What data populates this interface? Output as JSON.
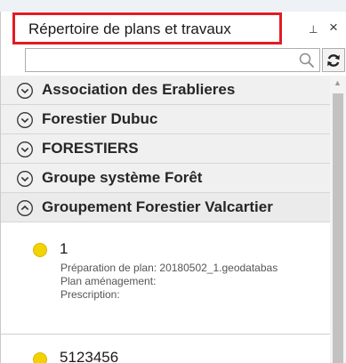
{
  "panel": {
    "title": "Répertoire de plans et travaux",
    "pin_glyph": "⊥",
    "close_glyph": "×"
  },
  "search": {
    "value": "",
    "placeholder": "",
    "icon": "search-icon",
    "refresh_icon": "refresh-icon"
  },
  "groups": [
    {
      "label": "Association des Erablieres",
      "state": "collapsed"
    },
    {
      "label": "Forestier Dubuc",
      "state": "collapsed"
    },
    {
      "label": "FORESTIERS",
      "state": "collapsed"
    },
    {
      "label": "Groupe système Forêt",
      "state": "collapsed"
    },
    {
      "label": "Groupement Forestier Valcartier",
      "state": "expanded"
    }
  ],
  "items": [
    {
      "id": "1",
      "details": [
        "Préparation de plan: 20180502_1.geodatabas",
        "Plan aménagement:",
        "Prescription:"
      ],
      "status_color": "#f2d300"
    },
    {
      "id": "5123456",
      "status_color": "#f2d300"
    }
  ],
  "colors": {
    "highlight": "#e21b23",
    "status_dot": "#f2d300"
  }
}
